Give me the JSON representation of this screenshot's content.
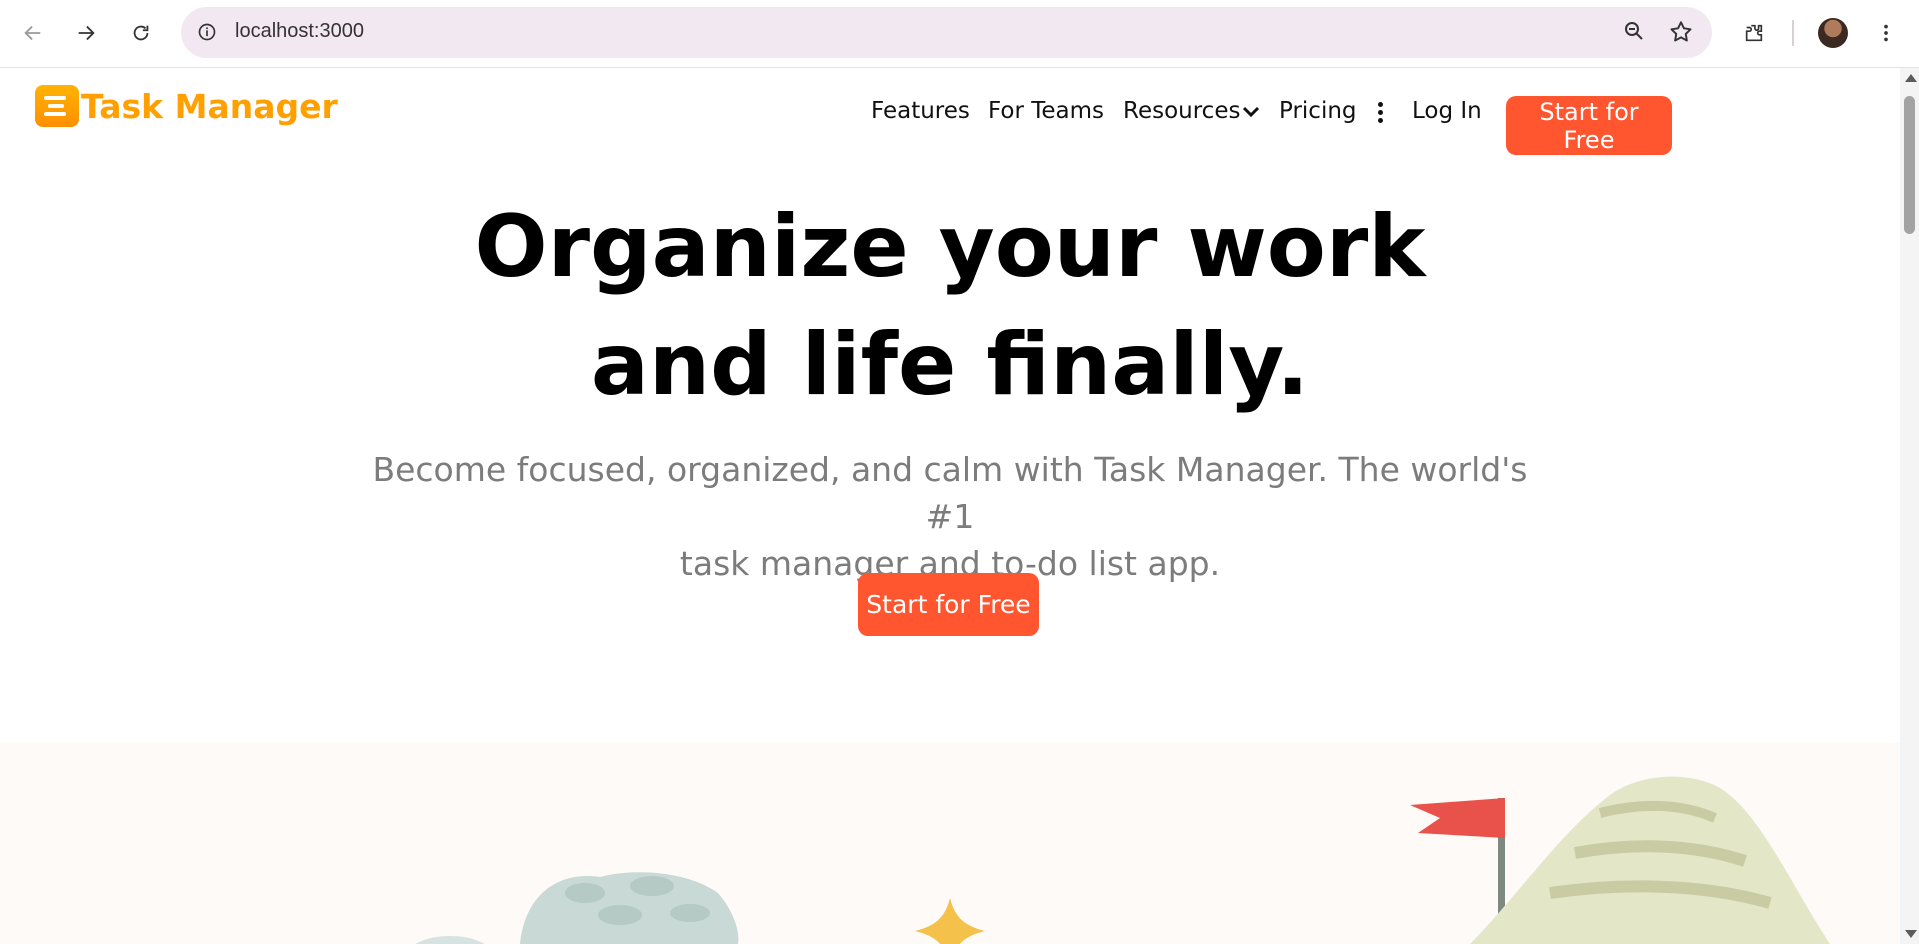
{
  "browser": {
    "url": "localhost:3000",
    "icons": [
      "back-arrow-icon",
      "forward-arrow-icon",
      "reload-icon",
      "site-info-icon",
      "zoom-icon",
      "bookmark-star-icon",
      "extensions-icon",
      "profile-avatar",
      "chrome-menu-icon"
    ]
  },
  "brand": {
    "name": "Task Manager",
    "color": "#ffa000"
  },
  "nav": {
    "items": [
      "Features",
      "For Teams",
      "Resources",
      "Pricing"
    ],
    "login": "Log In",
    "cta": "Start for Free"
  },
  "hero": {
    "title_line1": "Organize your work",
    "title_line2": "and life finally.",
    "subtitle_line1": "Become focused, organized, and calm with Task Manager. The world's #1",
    "subtitle_line2": "task manager and to-do list app.",
    "cta": "Start for Free"
  },
  "colors": {
    "accent": "#ff5630",
    "subtitle": "#7c7c7c",
    "illustration_bg": "#fdfaf8"
  }
}
